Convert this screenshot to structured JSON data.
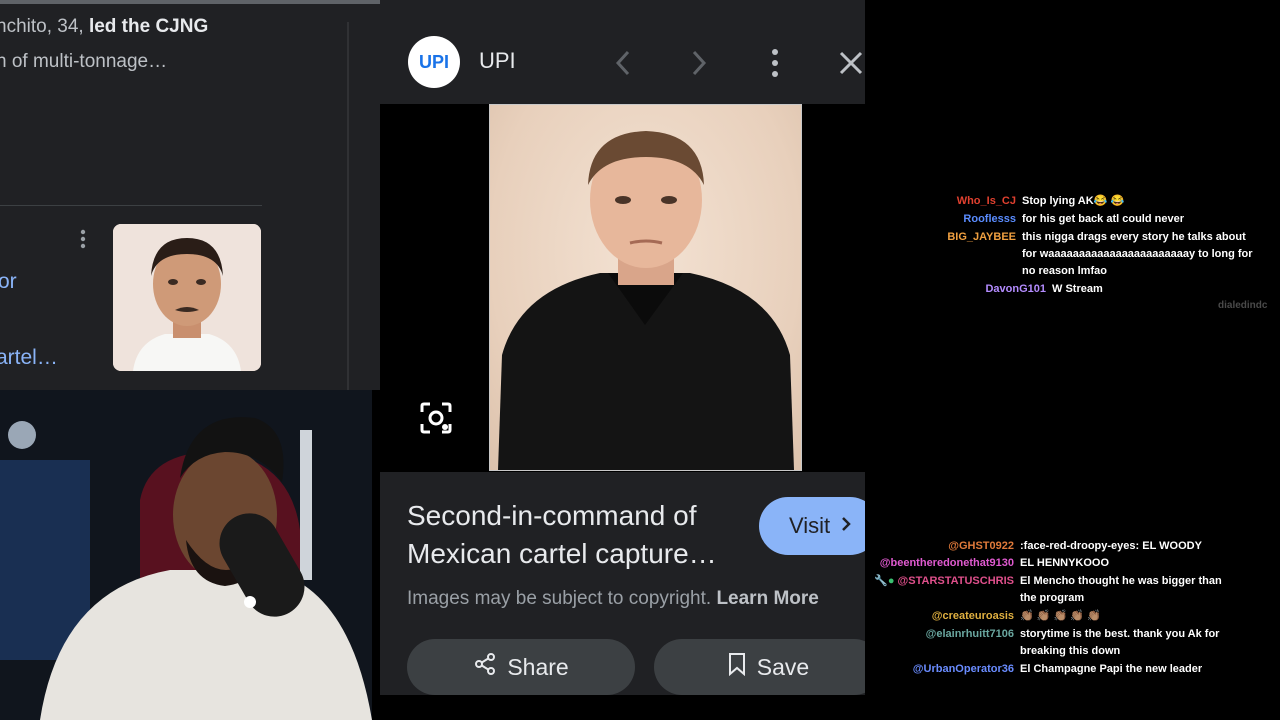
{
  "results": {
    "snippet_line1_prefix": "nchito, 34, ",
    "snippet_line1_bold": "led the CJNG",
    "snippet_line2": "n of multi-tonnage…",
    "link_line1": "or",
    "link_line2": "artel…"
  },
  "viewer": {
    "source_name": "UPI",
    "source_logo_text": "UPI",
    "caption": "Second-in-command of Mexican cartel capture…",
    "visit_label": "Visit",
    "copyright_text": "Images may be subject to copyright.",
    "learn_more_label": "Learn More",
    "share_label": "Share",
    "save_label": "Save"
  },
  "chat": {
    "watermark": "dialedindc",
    "top_messages": [
      {
        "user": "Who_Is_CJ",
        "color": "#e0402f",
        "text": "Stop lying AK😂 😂"
      },
      {
        "user": "Rooflesss",
        "color": "#5a8cff",
        "text": "for his get back atl could never"
      },
      {
        "user": "BIG_JAYBEE",
        "color": "#f0a040",
        "text": "this nigga drags every story he talks about for waaaaaaaaaaaaaaaaaaaaaaay to long for no reason lmfao"
      },
      {
        "user": "DavonG101",
        "color": "#b48cff",
        "text": "W Stream"
      }
    ],
    "bottom_messages": [
      {
        "user": "@GHST0922",
        "color": "#e07a3a",
        "text": ":face-red-droopy-eyes: EL WOODY"
      },
      {
        "user": "@beentheredonethat9130",
        "color": "#e05ad0",
        "text": "EL HENNYKOOO"
      },
      {
        "user": "@STARSTATUSCHRIS",
        "color": "#e0508c",
        "text": "El Mencho thought he was bigger than the program"
      },
      {
        "user": "@createuroasis",
        "color": "#e0b040",
        "text": "👏🏽 👏🏽 👏🏽 👏🏽 👏🏽"
      },
      {
        "user": "@elainrhuitt7106",
        "color": "#6aa7a0",
        "text": "storytime is the best. thank you Ak for breaking this down"
      },
      {
        "user": "@UrbanOperator36",
        "color": "#6a8cff",
        "text": "El Champagne Papi the new leader"
      }
    ]
  },
  "colors": {
    "accent_blue": "#8ab4f8",
    "panel_bg": "#202124"
  }
}
